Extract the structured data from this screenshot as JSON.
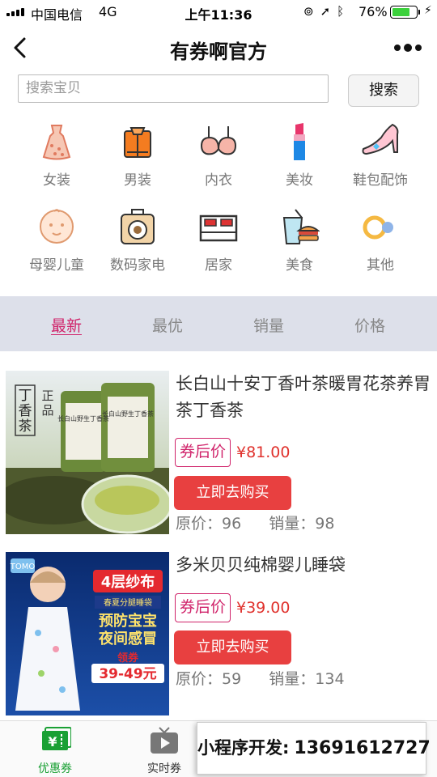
{
  "status_bar": {
    "carrier": "中国电信",
    "network": "4G",
    "time": "上午11:36",
    "battery_percent": "76%",
    "battery_level": 0.76
  },
  "nav": {
    "title": "有券啊官方"
  },
  "search": {
    "placeholder": "搜索宝贝",
    "button_label": "搜索"
  },
  "categories": [
    {
      "label": "女装",
      "icon": "dress-icon"
    },
    {
      "label": "男装",
      "icon": "shirt-icon"
    },
    {
      "label": "内衣",
      "icon": "bra-icon"
    },
    {
      "label": "美妆",
      "icon": "lipstick-icon"
    },
    {
      "label": "鞋包配饰",
      "icon": "high-heel-icon"
    },
    {
      "label": "母婴儿童",
      "icon": "baby-face-icon"
    },
    {
      "label": "数码家电",
      "icon": "radio-icon"
    },
    {
      "label": "居家",
      "icon": "bed-icon"
    },
    {
      "label": "美食",
      "icon": "drink-burger-icon"
    },
    {
      "label": "其他",
      "icon": "rings-icon"
    }
  ],
  "sort_tabs": [
    {
      "label": "最新",
      "active": true
    },
    {
      "label": "最优",
      "active": false
    },
    {
      "label": "销量",
      "active": false
    },
    {
      "label": "价格",
      "active": false
    }
  ],
  "products": [
    {
      "name": "长白山十安丁香叶茶暖胃花茶养胃茶丁香茶",
      "coupon_label": "券后价",
      "coupon_price": "¥81.00",
      "buy_label": "立即去购买",
      "original_label": "原价：",
      "original_price": "96",
      "sales_label": "销量：",
      "sales": "98",
      "thumb_text": {
        "vertical_name": "丁香茶",
        "seal": "正品",
        "can_text": "长白山野生丁香茶"
      }
    },
    {
      "name": "多米贝贝纯棉婴儿睡袋",
      "coupon_label": "券后价",
      "coupon_price": "¥39.00",
      "buy_label": "立即去购买",
      "original_label": "原价：",
      "original_price": "59",
      "sales_label": "销量：",
      "sales": "134",
      "thumb_text": {
        "brand": "TOMO",
        "headline": "4层纱布",
        "subline": "春夏分腿睡袋",
        "slogan1": "预防宝宝",
        "slogan2": "夜间感冒",
        "coupon_tag": "领券",
        "coupon_range": "39-49元"
      }
    }
  ],
  "tab_bar": [
    {
      "label": "优惠券",
      "active": true,
      "icon": "coupon-ticket-icon"
    },
    {
      "label": "实时券",
      "active": false,
      "icon": "tv-play-icon"
    }
  ],
  "promo": {
    "text": "小程序开发:",
    "phone": "13691612727"
  },
  "colors": {
    "accent": "#d0236a",
    "price": "#e0322d",
    "buy_button": "#e84040",
    "sort_bar_bg": "#dde0ea",
    "tab_active": "#1aa034"
  }
}
